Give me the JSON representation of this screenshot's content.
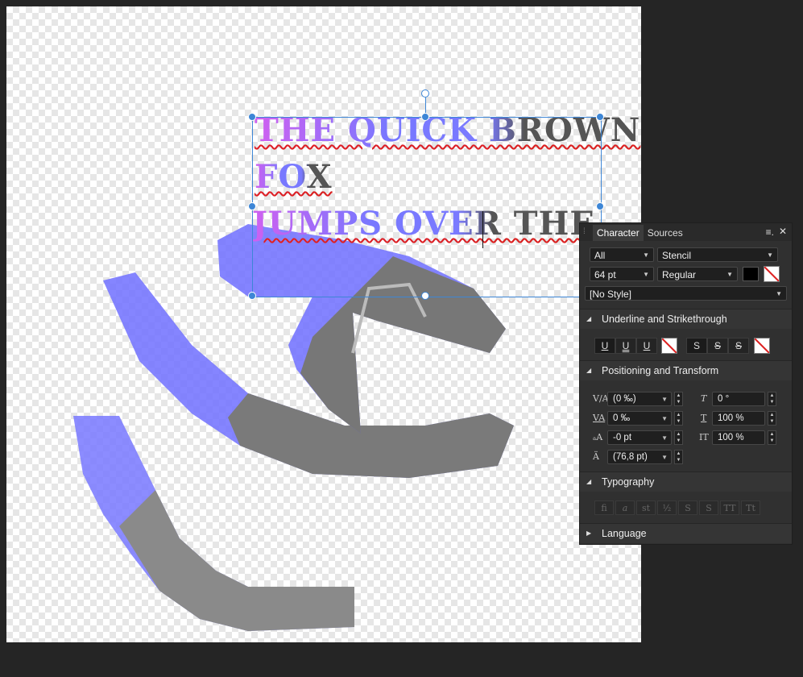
{
  "document": {
    "text_lines": [
      "THE QUICK BROWN",
      " FOX",
      "JUMPS OVER THE"
    ]
  },
  "panel": {
    "tabs": [
      "Character",
      "Sources"
    ],
    "active_tab": "Character",
    "menu_icon": "panel-menu-icon",
    "close_icon": "close-icon",
    "font_collection": "All",
    "font_family": "Stencil",
    "font_size": "64 pt",
    "font_style": "Regular",
    "text_color": "#000000",
    "style": "[No Style]",
    "sections": {
      "underline": "Underline and Strikethrough",
      "positioning": "Positioning and Transform",
      "typography": "Typography",
      "language": "Language"
    },
    "underline_buttons": [
      "U",
      "U",
      "U"
    ],
    "strike_buttons": [
      "S",
      "S",
      "S"
    ],
    "positioning": {
      "kerning": "(0 ‰)",
      "tracking": "0 ‰",
      "baseline": "-0 pt",
      "leading": "(76,8 pt)",
      "shear": "0 °",
      "vscale": "100 %",
      "hscale": "100 %"
    },
    "typography_buttons": [
      "fi",
      "a",
      "st",
      "½",
      "S",
      "S",
      "TT",
      "Tt"
    ]
  },
  "colors": {
    "accent": "#3d86d6",
    "panel_bg": "#303030",
    "workspace_bg": "#252525"
  }
}
